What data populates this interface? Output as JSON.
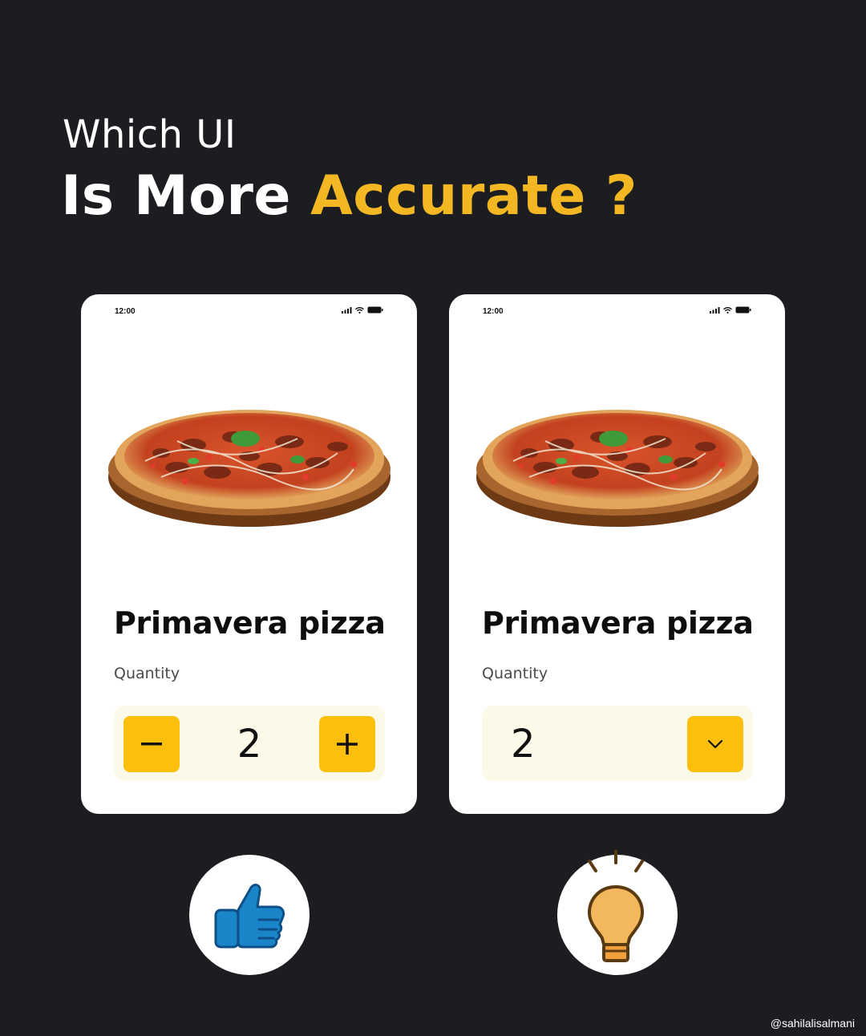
{
  "headline": {
    "line1": "Which UI",
    "line2_prefix": "Is More ",
    "line2_accent": "Accurate ?"
  },
  "colors": {
    "background": "#1b1d21",
    "accent_text": "#f3b724",
    "button_yellow": "#fbbf0c",
    "qty_box_bg": "#fdf9e8",
    "thumbs_up_blue": "#1a85c8",
    "bulb_orange": "#f4b85c"
  },
  "cards": [
    {
      "status_time": "12:00",
      "product_name": "Primavera pizza",
      "quantity_label": "Quantity",
      "quantity_value": "2",
      "control_type": "stepper",
      "minus_icon": "minus-icon",
      "plus_icon": "plus-icon"
    },
    {
      "status_time": "12:00",
      "product_name": "Primavera pizza",
      "quantity_label": "Quantity",
      "quantity_value": "2",
      "control_type": "dropdown",
      "dropdown_icon": "chevron-down-icon"
    }
  ],
  "badges": [
    {
      "icon": "thumbs-up-icon"
    },
    {
      "icon": "lightbulb-icon"
    }
  ],
  "watermark": "@sahilalisalmani"
}
